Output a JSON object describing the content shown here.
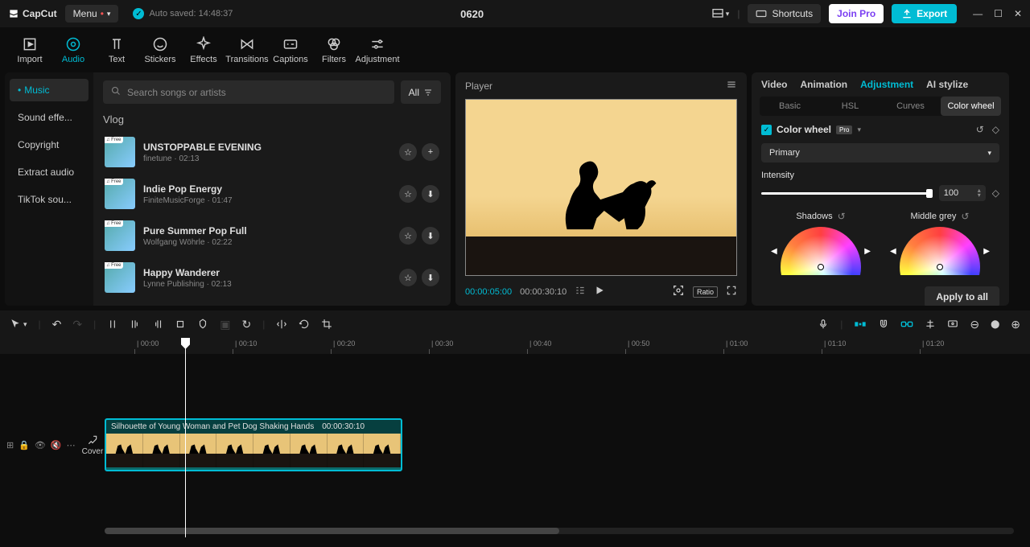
{
  "topbar": {
    "logo": "CapCut",
    "menu": "Menu",
    "autosave": "Auto saved: 14:48:37",
    "title": "0620",
    "shortcuts": "Shortcuts",
    "joinpro": "Join Pro",
    "export": "Export"
  },
  "tooltabs": [
    "Import",
    "Audio",
    "Text",
    "Stickers",
    "Effects",
    "Transitions",
    "Captions",
    "Filters",
    "Adjustment"
  ],
  "leftnav": [
    "Music",
    "Sound effe...",
    "Copyright",
    "Extract audio",
    "TikTok sou..."
  ],
  "search": {
    "placeholder": "Search songs or artists",
    "all": "All"
  },
  "section": "Vlog",
  "songs": [
    {
      "title": "UNSTOPPABLE EVENING",
      "artist": "finetune",
      "dur": "02:13",
      "add": true
    },
    {
      "title": "Indie Pop Energy",
      "artist": "FiniteMusicForge",
      "dur": "01:47",
      "add": false
    },
    {
      "title": "Pure Summer Pop Full",
      "artist": "Wolfgang Wöhrle",
      "dur": "02:22",
      "add": false
    },
    {
      "title": "Happy Wanderer",
      "artist": "Lynne Publishing",
      "dur": "02:13",
      "add": false
    }
  ],
  "player": {
    "title": "Player",
    "tc1": "00:00:05:00",
    "tc2": "00:00:30:10",
    "ratio": "Ratio"
  },
  "rtabs": [
    "Video",
    "Animation",
    "Adjustment",
    "AI stylize"
  ],
  "rsubtabs": [
    "Basic",
    "HSL",
    "Curves",
    "Color wheel"
  ],
  "cw": {
    "label": "Color wheel",
    "pro": "Pro",
    "select": "Primary",
    "intensity_label": "Intensity",
    "intensity_value": "100",
    "shadows": "Shadows",
    "middlegrey": "Middle grey",
    "apply": "Apply to all"
  },
  "ruler": [
    "00:00",
    "00:10",
    "00:20",
    "00:30",
    "00:40",
    "00:50",
    "01:00",
    "01:10",
    "01:20"
  ],
  "cover": "Cover",
  "clip": {
    "name": "Silhouette of Young Woman and Pet Dog Shaking Hands",
    "dur": "00:00:30:10"
  }
}
